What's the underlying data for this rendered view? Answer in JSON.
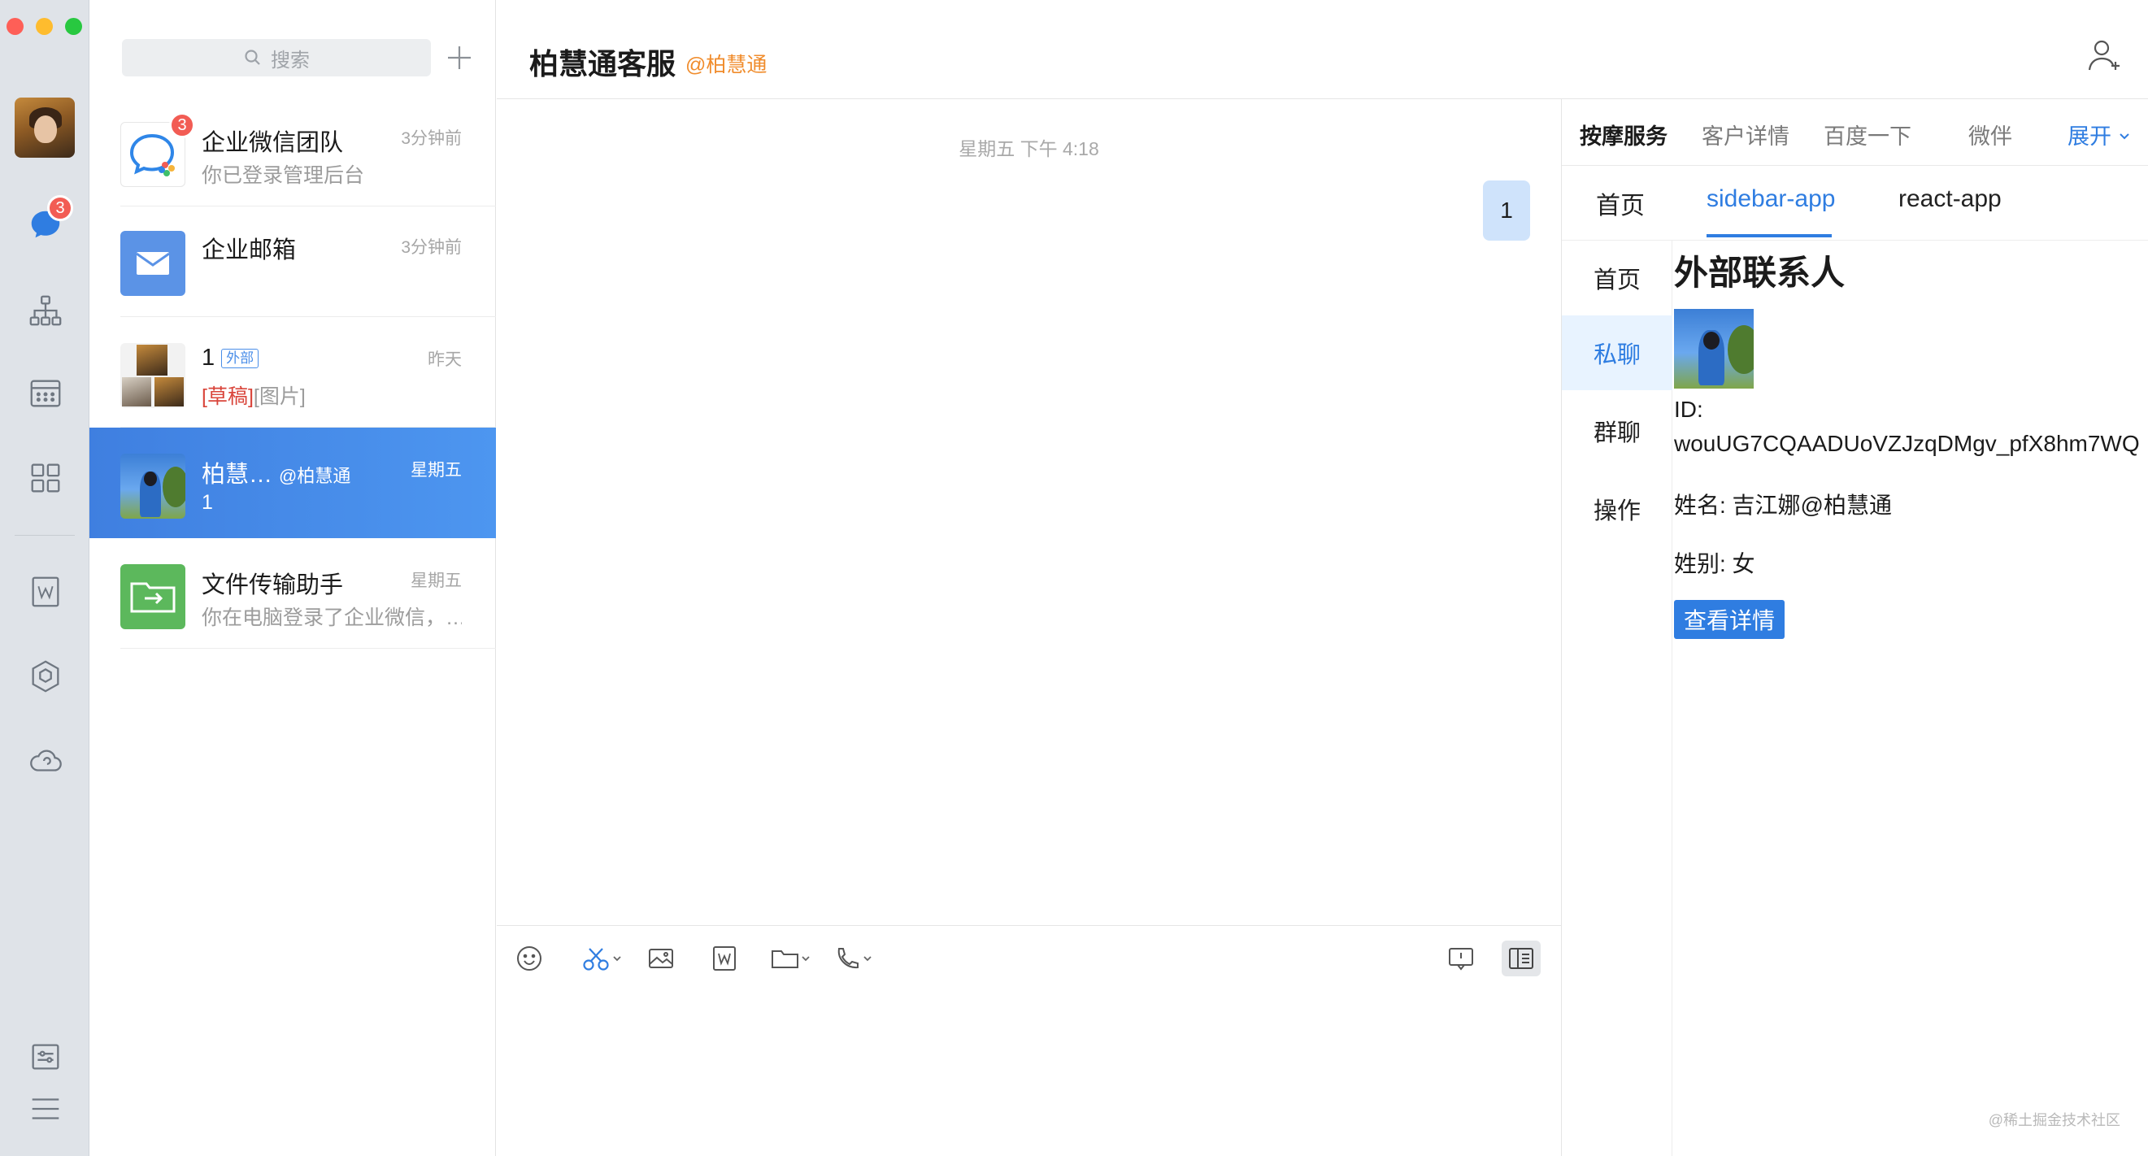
{
  "window": {
    "traffic_lights": [
      "close",
      "minimize",
      "zoom"
    ]
  },
  "rail": {
    "items": [
      {
        "name": "avatar"
      },
      {
        "name": "messages-icon",
        "badge": "3",
        "color": "#2f7de1"
      },
      {
        "name": "contacts-icon"
      },
      {
        "name": "calendar-icon"
      },
      {
        "name": "workbench-icon"
      },
      {
        "name": "docs-icon"
      },
      {
        "name": "apps-icon"
      },
      {
        "name": "drive-icon"
      },
      {
        "name": "settings-icon"
      },
      {
        "name": "menu-icon"
      }
    ]
  },
  "convlist": {
    "search_placeholder": "搜索",
    "conversations": [
      {
        "name": "企业微信团队",
        "time": "3分钟前",
        "preview": "你已登录管理后台",
        "badge": "3"
      },
      {
        "name": "企业邮箱",
        "time": "3分钟前",
        "preview": ""
      },
      {
        "name": "1",
        "tag": "外部",
        "time": "昨天",
        "draft": "[草稿]",
        "preview": "[图片]"
      },
      {
        "name": "柏慧…",
        "at": "@柏慧通",
        "time": "星期五",
        "preview": "1",
        "active": true
      },
      {
        "name": "文件传输助手",
        "time": "星期五",
        "preview": "你在电脑登录了企业微信，…"
      }
    ]
  },
  "chat": {
    "title": "柏慧通客服",
    "subtitle": "@柏慧通",
    "timestamp": "星期五 下午 4:18",
    "messages": [
      {
        "from": "me",
        "text": "1"
      }
    ]
  },
  "toolbar": {
    "items": [
      "emoji-icon",
      "screenshot-icon",
      "image-icon",
      "doc-icon",
      "folder-icon",
      "call-icon",
      "chat-history-icon",
      "sidebar-toggle-icon"
    ]
  },
  "sidebar": {
    "tabs": [
      {
        "label": "按摩服务",
        "active": true
      },
      {
        "label": "客户详情"
      },
      {
        "label": "百度一下"
      },
      {
        "label": "微伴"
      },
      {
        "label": "展开"
      }
    ],
    "app_tabs": [
      {
        "label": "首页"
      },
      {
        "label": "sidebar-app",
        "active": true
      },
      {
        "label": "react-app"
      }
    ],
    "nav": [
      {
        "label": "首页"
      },
      {
        "label": "私聊",
        "active": true
      },
      {
        "label": "群聊"
      },
      {
        "label": "操作"
      }
    ],
    "contact": {
      "heading": "外部联系人",
      "id_label": "ID:",
      "id_value": "wouUG7CQAADUoVZJzqDMgv_pfX8hm7WQ",
      "name_line": "姓名: 吉江娜@柏慧通",
      "gender_line": "姓别: 女",
      "detail_button": "查看详情"
    }
  },
  "watermark": "@稀土掘金技术社区",
  "colors": {
    "accent": "#2f7de1",
    "active_conv": "#4a8ee8",
    "badge": "#f25c54",
    "subtitle": "#f08c2c",
    "bubble": "#cfe3fb"
  }
}
